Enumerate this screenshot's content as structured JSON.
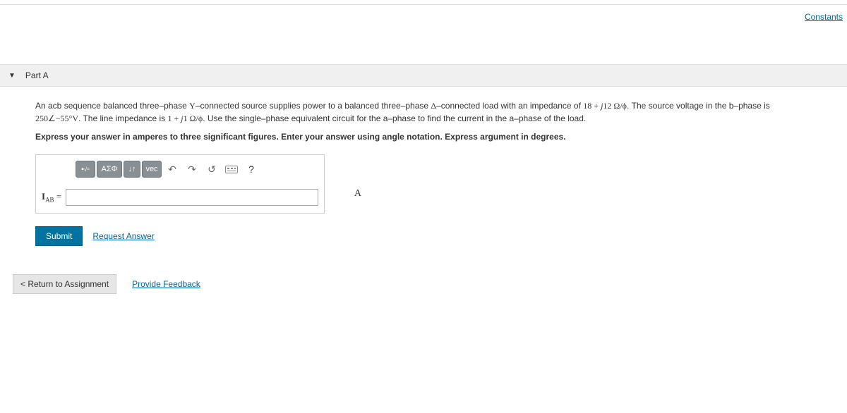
{
  "header": {
    "constants_link": "Constants"
  },
  "part": {
    "title": "Part A"
  },
  "problem": {
    "text_html": "An acb sequence balanced three–phase <span class='serif'>Y</span>–connected source supplies power to a balanced three–phase <span class='serif delta'>Δ</span>–connected load with an impedance of <span class='serif'>18 + <i>j</i>12 Ω/ϕ</span>. The source voltage in the b–phase is <span class='serif'>250∠−55°V</span>. The line impedance is <span class='serif'>1 + <i>j</i>1 Ω/ϕ</span>. Use the single–phase equivalent circuit for the a–phase to find the current in the a–phase of the load.",
    "instruction": "Express your answer in amperes to three significant figures. Enter your answer using angle notation. Express argument in degrees."
  },
  "toolbar": {
    "templates": "■√̅□",
    "greek": "ΑΣΦ",
    "updown": "↓↑",
    "vec": "vec",
    "undo": "↶",
    "redo": "↷",
    "reset": "↺",
    "help": "?"
  },
  "answer": {
    "variable_html": "<b>I</b><sub class='sub'>AB</sub> =",
    "value": "",
    "unit": "A"
  },
  "actions": {
    "submit": "Submit",
    "request_answer": "Request Answer"
  },
  "footer": {
    "return": "< Return to Assignment",
    "feedback": "Provide Feedback"
  }
}
